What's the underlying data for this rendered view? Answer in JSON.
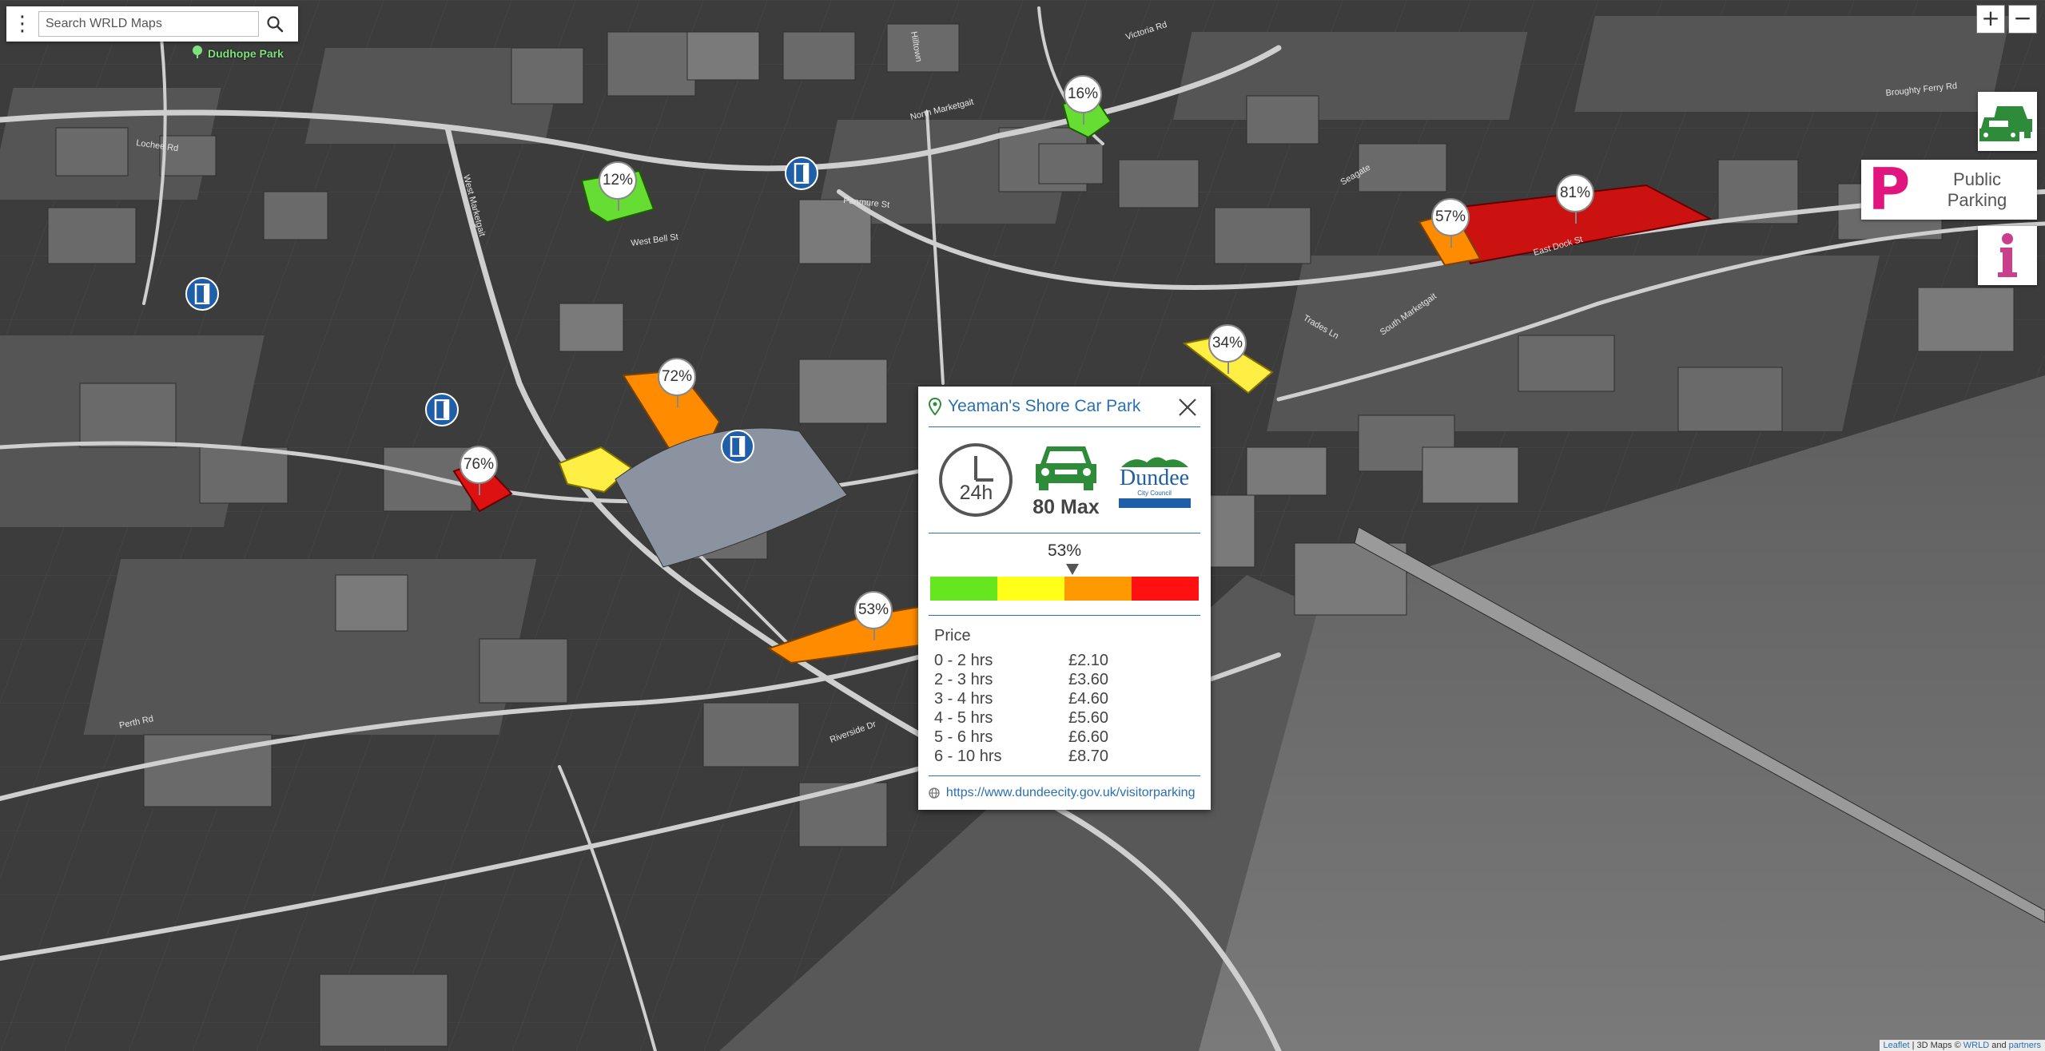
{
  "search": {
    "placeholder": "Search WRLD Maps",
    "menu_icon": "more-vertical-icon",
    "search_icon": "search-icon"
  },
  "poi": {
    "name": "Dudhope Park",
    "icon": "tree-icon",
    "color": "#7fe27f"
  },
  "zoom": {
    "in_label": "+",
    "out_label": "−"
  },
  "side_buttons": [
    {
      "icon": "car-park-icon"
    },
    {
      "label": "Public\nParking",
      "glyph": "P",
      "color": "#e0157e"
    },
    {
      "icon": "info-icon"
    }
  ],
  "street_labels": [
    "North Marketgait",
    "Victoria Rd",
    "Lochee Rd",
    "West Marketgait",
    "West Bell St",
    "Panmure St",
    "Perth Rd",
    "South Marketgait",
    "Riverside Dr",
    "East Dock St",
    "Broughty Ferry Rd",
    "Trades Ln",
    "Seagate",
    "Hilltown"
  ],
  "occupancy_markers": [
    "16%",
    "12%",
    "81%",
    "57%",
    "34%",
    "72%",
    "76%",
    "53%"
  ],
  "car_parks": [
    {
      "label": "16%",
      "color": "#66dd33"
    },
    {
      "label": "12%",
      "color": "#66dd33"
    },
    {
      "label": "81%",
      "color": "#cc1111"
    },
    {
      "label": "57%",
      "color": "#ff8c00"
    },
    {
      "label": "34%",
      "color": "#ffee44"
    },
    {
      "label": "72%",
      "color": "#ff8c00"
    },
    {
      "label": "76%",
      "color": "#dd1111"
    },
    {
      "label": "53%",
      "color": "#ff8c00"
    }
  ],
  "popup": {
    "title": "Yeaman's Shore Car Park",
    "hours": "24h",
    "capacity": "80 Max",
    "logo_text": "Dundee",
    "logo_sub": "City Council",
    "occupancy": "53%",
    "occupancy_value": 0.53,
    "bar_colors": [
      "#66e61e",
      "#ffff1a",
      "#ff9900",
      "#ff1111"
    ],
    "price_title": "Price",
    "prices": [
      {
        "range": "0 - 2 hrs",
        "price": "£2.10"
      },
      {
        "range": "2 - 3 hrs",
        "price": "£3.60"
      },
      {
        "range": "3 - 4 hrs",
        "price": "£4.60"
      },
      {
        "range": "4 - 5 hrs",
        "price": "£5.60"
      },
      {
        "range": "5 - 6 hrs",
        "price": "£6.60"
      },
      {
        "range": "6 - 10 hrs",
        "price": "£8.70"
      }
    ],
    "link": "https://www.dundeecity.gov.uk/visitorparking"
  },
  "attribution": {
    "leaflet": "Leaflet",
    "sep": "|",
    "text": "3D Maps ©",
    "wrld": "WRLD",
    "and": "and",
    "partners": "partners"
  }
}
